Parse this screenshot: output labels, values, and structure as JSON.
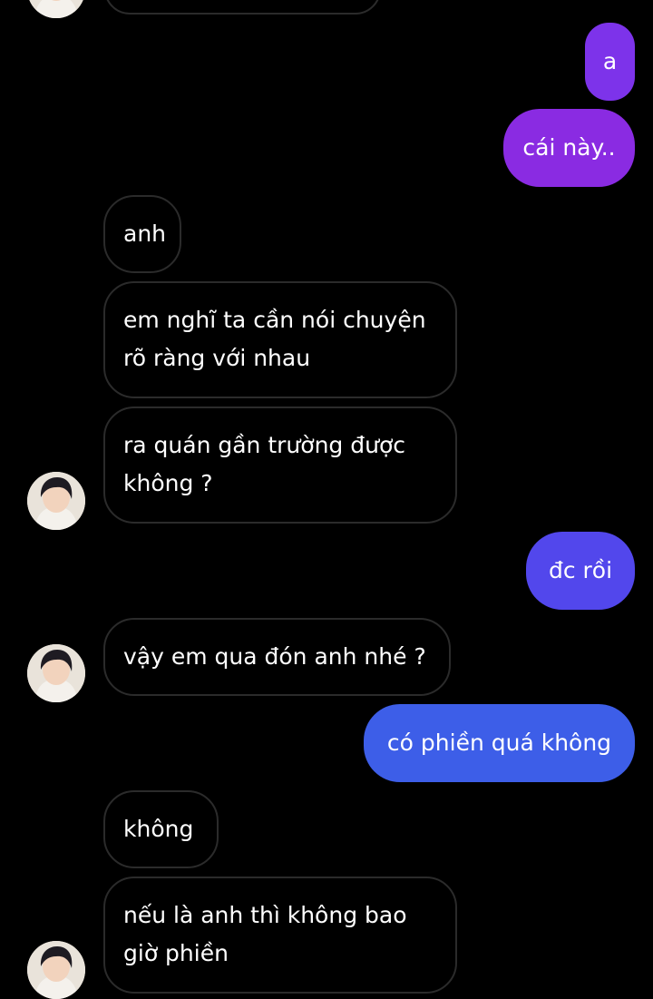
{
  "colors": {
    "background": "#000000",
    "incoming_border": "#2b2b2b",
    "outgoing_purple": "#8a2be2",
    "outgoing_violet": "#6b3cf0",
    "outgoing_blue": "#3d5ee8"
  },
  "avatar": {
    "icon": "profile-photo-icon"
  },
  "messages": [
    {
      "text": "a",
      "sender": "me"
    },
    {
      "text": "cái này..",
      "sender": "me"
    },
    {
      "text": "anh",
      "sender": "them"
    },
    {
      "lines": [
        "em nghĩ ta cần nói chuyện",
        "rõ ràng với nhau"
      ],
      "sender": "them"
    },
    {
      "lines": [
        "ra quán gần trường được",
        "không ?"
      ],
      "sender": "them"
    },
    {
      "text": "đc rồi",
      "sender": "me"
    },
    {
      "text": "vậy em qua đón anh nhé ?",
      "sender": "them"
    },
    {
      "text": "có phiền quá không",
      "sender": "me"
    },
    {
      "text": "không",
      "sender": "them"
    },
    {
      "lines": [
        "nếu là anh thì không bao",
        "giờ phiền"
      ],
      "sender": "them"
    }
  ]
}
